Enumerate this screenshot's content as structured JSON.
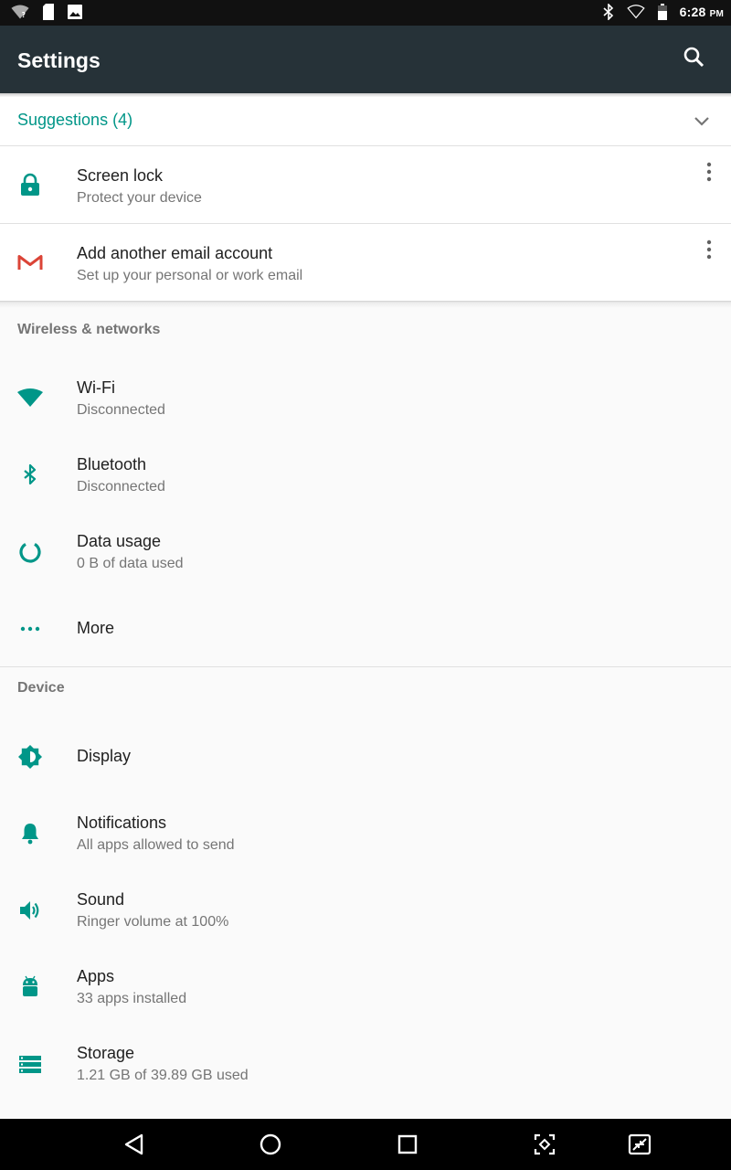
{
  "status_bar": {
    "time": "6:28",
    "ampm": "PM"
  },
  "app_bar": {
    "title": "Settings"
  },
  "suggestions": {
    "title": "Suggestions (4)",
    "items": [
      {
        "title": "Screen lock",
        "subtitle": "Protect your device",
        "icon": "lock-icon"
      },
      {
        "title": "Add another email account",
        "subtitle": "Set up your personal or work email",
        "icon": "gmail-icon"
      }
    ]
  },
  "sections": [
    {
      "header": "Wireless & networks",
      "items": [
        {
          "title": "Wi-Fi",
          "subtitle": "Disconnected",
          "icon": "wifi-icon"
        },
        {
          "title": "Bluetooth",
          "subtitle": "Disconnected",
          "icon": "bluetooth-icon"
        },
        {
          "title": "Data usage",
          "subtitle": "0 B of data used",
          "icon": "data-usage-icon"
        },
        {
          "title": "More",
          "icon": "more-horiz-icon"
        }
      ]
    },
    {
      "header": "Device",
      "items": [
        {
          "title": "Display",
          "icon": "brightness-icon"
        },
        {
          "title": "Notifications",
          "subtitle": "All apps allowed to send",
          "icon": "bell-icon"
        },
        {
          "title": "Sound",
          "subtitle": "Ringer volume at 100%",
          "icon": "volume-icon"
        },
        {
          "title": "Apps",
          "subtitle": "33 apps installed",
          "icon": "android-icon"
        },
        {
          "title": "Storage",
          "subtitle": "1.21 GB of 39.89 GB used",
          "icon": "storage-icon"
        }
      ]
    }
  ],
  "colors": {
    "accent": "#009688",
    "app_bar": "#263238",
    "background": "#fafafa"
  }
}
